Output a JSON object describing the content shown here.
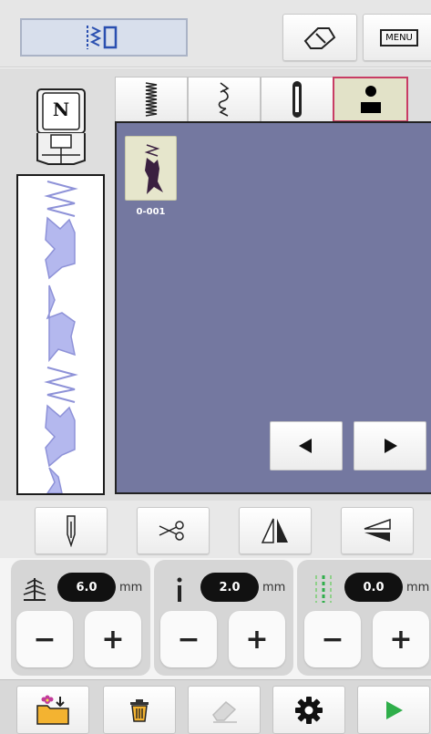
{
  "topbar": {
    "stitch_display_icon": "stitch-mode-icon",
    "home_icon": "eraser-home-icon",
    "menu_label": "MENU"
  },
  "presser_foot": {
    "letter": "N"
  },
  "tabs": [
    {
      "icon": "zigzag-stitch-icon"
    },
    {
      "icon": "decorative-stitch-icon"
    },
    {
      "icon": "buttonhole-icon"
    },
    {
      "icon": "personal-pattern-icon",
      "active": true
    }
  ],
  "patterns": [
    {
      "code": "0-001"
    }
  ],
  "params": [
    {
      "icon": "stitch-width-icon",
      "value": "6.0",
      "unit": "mm",
      "minus": "−",
      "plus": "+"
    },
    {
      "icon": "stitch-length-icon",
      "value": "2.0",
      "unit": "mm",
      "minus": "−",
      "plus": "+"
    },
    {
      "icon": "needle-position-icon",
      "value": "0.0",
      "unit": "mm",
      "minus": "−",
      "plus": "+"
    }
  ],
  "colors": {
    "accent_border": "#c83c64",
    "pattern_bg": "#7478a0",
    "play_green": "#2fae4a"
  }
}
